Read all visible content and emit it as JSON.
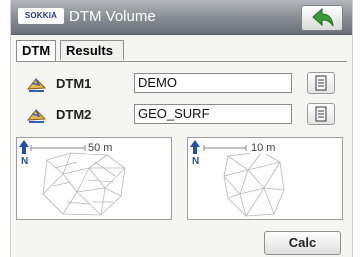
{
  "window": {
    "logo_text": "SOKKIA",
    "title": "DTM Volume"
  },
  "tabs": [
    {
      "label": "DTM",
      "active": true
    },
    {
      "label": "Results",
      "active": false
    }
  ],
  "rows": [
    {
      "label": "DTM1",
      "value": "DEMO"
    },
    {
      "label": "DTM2",
      "value": "GEO_SURF"
    }
  ],
  "previews": [
    {
      "scale_label": "50 m",
      "north_label": "N"
    },
    {
      "scale_label": "10 m",
      "north_label": "N"
    }
  ],
  "buttons": {
    "calc_label": "Calc"
  },
  "colors": {
    "titlebar": "#868a92",
    "back_arrow": "#3a9a3a",
    "north_arrow": "#1f4fb0"
  },
  "icons": [
    "back-arrow-icon",
    "dtm-surface-icon",
    "file-list-icon",
    "north-arrow-icon"
  ]
}
